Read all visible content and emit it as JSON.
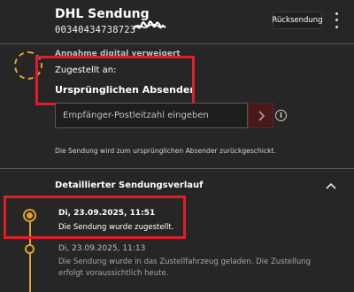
{
  "header": {
    "title": "DHL Sendung",
    "tracking_number": "00340434738723",
    "return_button": "Rücksendung"
  },
  "status": {
    "heading_obscured": "Annahme digital verweigert",
    "delivered_label": "Zugestellt an:",
    "recipient": "Ursprünglichen Absender",
    "postal_placeholder": "Empfänger-Postleitzahl eingeben",
    "submit_icon": "chevron-right-icon",
    "info_icon_glyph": "i",
    "note": "Die Sendung wird zum ursprünglichen Absender zurückgeschickt."
  },
  "history": {
    "title": "Detaillierter Sendungsverlauf",
    "events": [
      {
        "date": "Di, 23.09.2025, 11:51",
        "text": "Die Sendung wurde zugestellt."
      },
      {
        "date": "Di, 23.09.2025, 11:13",
        "text": "Die Sendung wurde in das Zustellfahrzeug geladen. Die Zustellung erfolgt voraussichtlich heute."
      }
    ]
  },
  "colors": {
    "background": "#262626",
    "accent": "#e2a02a",
    "highlight_red": "#e01e2b",
    "submit_button": "#4a1a1a"
  }
}
